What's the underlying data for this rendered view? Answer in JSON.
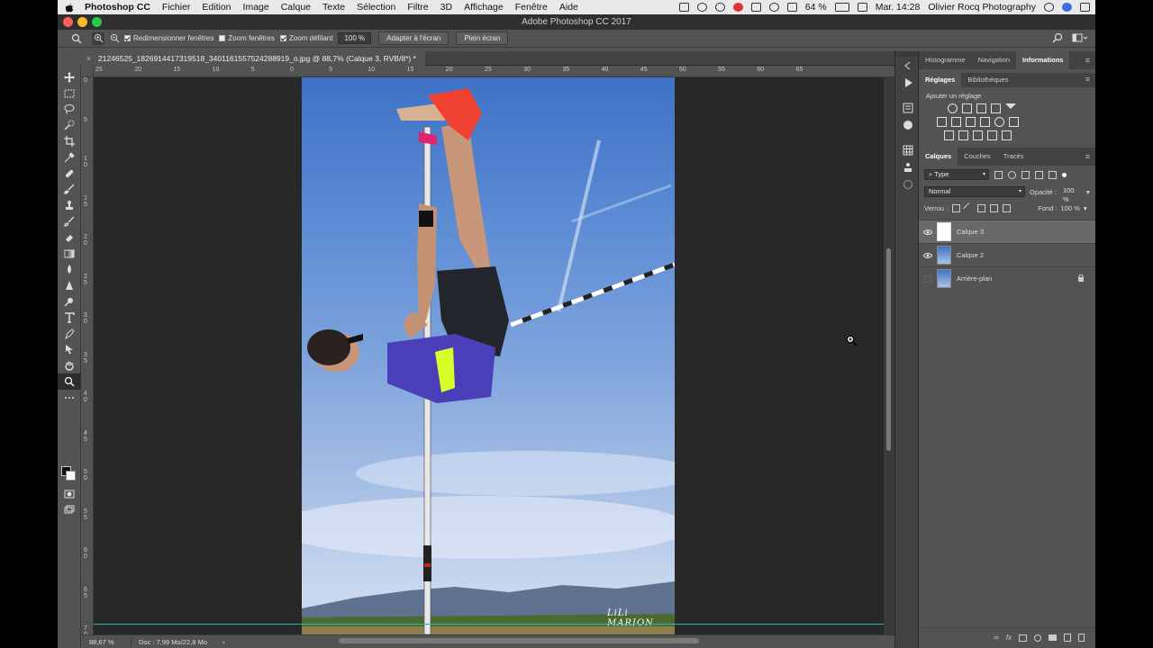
{
  "menubar": {
    "app_name": "Photoshop CC",
    "items": [
      "Fichier",
      "Edition",
      "Image",
      "Calque",
      "Texte",
      "Sélection",
      "Filtre",
      "3D",
      "Affichage",
      "Fenêtre",
      "Aide"
    ],
    "battery": "64 %",
    "clock": "Mar. 14:28",
    "user": "Olivier Rocq Photography"
  },
  "window": {
    "title": "Adobe Photoshop CC 2017"
  },
  "options": {
    "resize_windows": "Redimensionner fenêtres",
    "zoom_all": "Zoom fenêtres",
    "scrubby_zoom": "Zoom défilant",
    "zoom_value": "100 %",
    "fit_screen": "Adapter à l'écran",
    "fill_screen": "Plein écran"
  },
  "document": {
    "tab_title": "21246525_1826914417319518_340116155752428891​9_o.jpg @ 88,7% (Calque 3, RVB/8*) *",
    "close": "×",
    "watermark": "LiLi MARION"
  },
  "rulers": {
    "top": [
      "25",
      "20",
      "15",
      "10",
      "5",
      "0",
      "5",
      "10",
      "15",
      "20",
      "25",
      "30",
      "35",
      "40",
      "45",
      "50",
      "55",
      "60",
      "65"
    ],
    "left": [
      "0",
      "5",
      "1 0",
      "1 5",
      "2 0",
      "2 5",
      "3 0",
      "3 5",
      "4 0",
      "4 5",
      "5 0",
      "5 5",
      "6 0",
      "6 5",
      "7 0"
    ]
  },
  "status": {
    "zoom": "88,67 %",
    "doc": "Doc : 7,99 Mo/22,8 Mo",
    "arrow": "›"
  },
  "panels": {
    "top_tabs": [
      "Histogramme",
      "Navigation",
      "Informations"
    ],
    "top_active": "Informations",
    "adjust_tabs": [
      "Réglages",
      "Bibliothèques"
    ],
    "adjust_title": "Ajouter un réglage",
    "layer_tabs": [
      "Calques",
      "Couches",
      "Tracés"
    ],
    "filter_kind": "Type",
    "blend_mode": "Normal",
    "opacity_label": "Opacité :",
    "opacity_value": "100 %",
    "lock_label": "Verrou :",
    "fill_label": "Fond :",
    "fill_value": "100 %",
    "layers": [
      {
        "name": "Calque 3",
        "visible": true,
        "active": true
      },
      {
        "name": "Calque 2",
        "visible": true,
        "active": false
      },
      {
        "name": "Arrière-plan",
        "visible": false,
        "active": false,
        "locked": true
      }
    ],
    "footer_icons": [
      "link-icon",
      "fx-icon",
      "mask-icon",
      "adjustment-icon",
      "folder-icon",
      "new-layer-icon",
      "trash-icon"
    ],
    "fx_label": "fx"
  },
  "colors": {
    "accent_guide": "#2db3b3",
    "panel_bg": "#535353",
    "pasteboard": "#282828"
  }
}
